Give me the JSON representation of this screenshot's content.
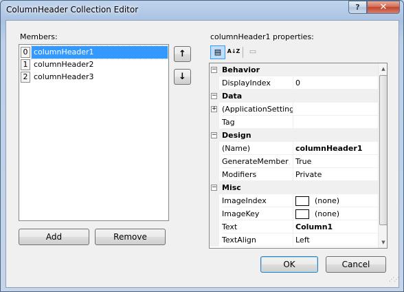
{
  "window": {
    "title": "ColumnHeader Collection Editor",
    "help_label": "?",
    "close_label": "✕"
  },
  "members": {
    "label": "Members:",
    "items": [
      {
        "index": "0",
        "name": "columnHeader1",
        "selected": true
      },
      {
        "index": "1",
        "name": "columnHeader2",
        "selected": false
      },
      {
        "index": "2",
        "name": "columnHeader3",
        "selected": false
      }
    ],
    "move_up_icon": "↑",
    "move_down_icon": "↓",
    "add_label": "Add",
    "remove_label": "Remove"
  },
  "properties": {
    "label": "columnHeader1 properties:",
    "toolbar": {
      "categorized_icon": "▤",
      "alphabetical_icon": "A↓Z",
      "property_pages_icon": "▭"
    },
    "rows": [
      {
        "type": "category",
        "name": "Behavior",
        "expander": "−"
      },
      {
        "type": "prop",
        "name": "DisplayIndex",
        "value": "0",
        "bold": false
      },
      {
        "type": "category",
        "name": "Data",
        "expander": "−"
      },
      {
        "type": "prop",
        "name": "(ApplicationSettings)",
        "value": "",
        "bold": false,
        "expander": "+"
      },
      {
        "type": "prop",
        "name": "Tag",
        "value": "",
        "bold": false
      },
      {
        "type": "category",
        "name": "Design",
        "expander": "−"
      },
      {
        "type": "prop",
        "name": "(Name)",
        "value": "columnHeader1",
        "bold": true
      },
      {
        "type": "prop",
        "name": "GenerateMember",
        "value": "True",
        "bold": false
      },
      {
        "type": "prop",
        "name": "Modifiers",
        "value": "Private",
        "bold": false
      },
      {
        "type": "category",
        "name": "Misc",
        "expander": "−"
      },
      {
        "type": "prop",
        "name": "ImageIndex",
        "value": "(none)",
        "bold": false,
        "swatch": true
      },
      {
        "type": "prop",
        "name": "ImageKey",
        "value": "(none)",
        "bold": false,
        "swatch": true
      },
      {
        "type": "prop",
        "name": "Text",
        "value": "Column1",
        "bold": true
      },
      {
        "type": "prop",
        "name": "TextAlign",
        "value": "Left",
        "bold": false
      }
    ],
    "scroll_up_icon": "▲",
    "scroll_down_icon": "▼"
  },
  "footer": {
    "ok_label": "OK",
    "cancel_label": "Cancel"
  }
}
